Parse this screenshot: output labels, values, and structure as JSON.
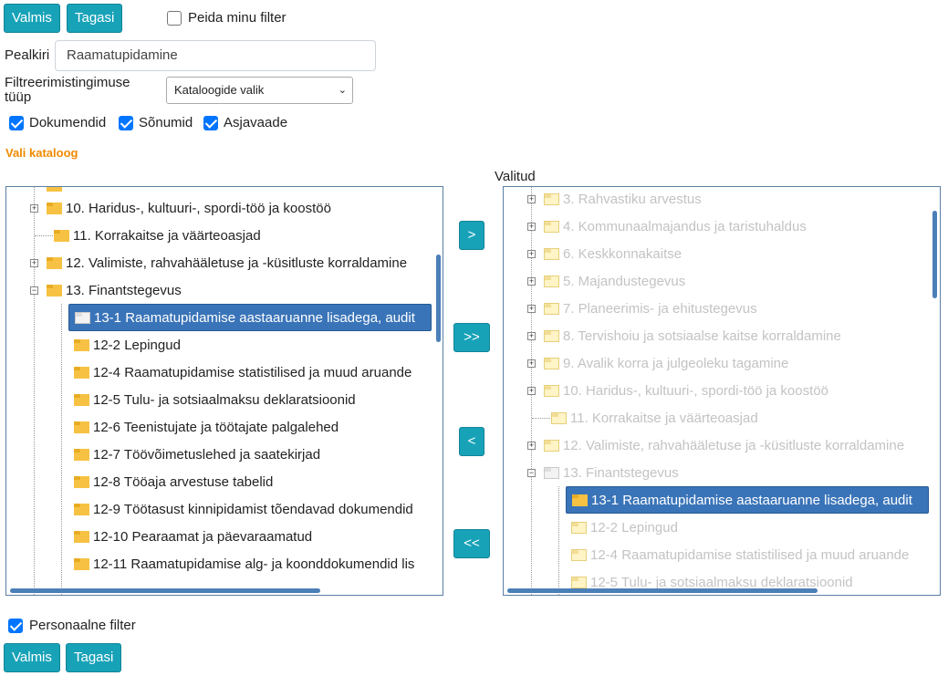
{
  "top_buttons": {
    "done": "Valmis",
    "back": "Tagasi"
  },
  "hide_filter": {
    "label": "Peida minu filter",
    "checked": false
  },
  "title_field": {
    "label": "Pealkiri",
    "value": "Raamatupidamine"
  },
  "filter_type": {
    "label": "Filtreerimistingimuse tüüp",
    "selected": "Kataloogide valik"
  },
  "types": [
    {
      "label": "Dokumendid",
      "checked": true
    },
    {
      "label": "Sõnumid",
      "checked": true
    },
    {
      "label": "Asjavaade",
      "checked": true
    }
  ],
  "catalog_heading": "Vali kataloog",
  "selected_heading": "Valitud",
  "left_tree": [
    {
      "label": "10. Haridus-, kultuuri-, spordi-töö ja koostöö"
    },
    {
      "label": "11. Korrakaitse ja väärteoasjad"
    },
    {
      "label": "12. Valimiste, rahvahääletuse ja -küsitluste korraldamine"
    },
    {
      "label": "13. Finantstegevus"
    },
    {
      "label": "13-1 Raamatupidamise aastaaruanne lisadega, audit"
    },
    {
      "label": "12-2 Lepingud"
    },
    {
      "label": "12-4 Raamatupidamise statistilised ja muud aruande"
    },
    {
      "label": "12-5 Tulu- ja sotsiaalmaksu deklaratsioonid"
    },
    {
      "label": "12-6 Teenistujate ja töötajate palgalehed"
    },
    {
      "label": "12-7 Töövõimetuslehed ja saatekirjad"
    },
    {
      "label": "12-8 Tööaja arvestuse tabelid"
    },
    {
      "label": "12-9 Töötasust kinnipidamist tõendavad dokumendid"
    },
    {
      "label": "12-10 Pearaamat ja päevaraamatud"
    },
    {
      "label": "12-11 Raamatupidamise alg- ja koonddokumendid lis"
    }
  ],
  "right_tree": [
    {
      "label": "3. Rahvastiku arvestus"
    },
    {
      "label": "4. Kommunaalmajandus ja taristuhaldus"
    },
    {
      "label": "6. Keskkonnakaitse"
    },
    {
      "label": "5. Majandustegevus"
    },
    {
      "label": "7. Planeerimis- ja ehitustegevus"
    },
    {
      "label": "8. Tervishoiu ja sotsiaalse kaitse korraldamine"
    },
    {
      "label": "9. Avalik korra ja julgeoleku tagamine"
    },
    {
      "label": "10. Haridus-, kultuuri-, spordi-töö ja koostöö"
    },
    {
      "label": "11. Korrakaitse ja väärteoasjad"
    },
    {
      "label": "12. Valimiste, rahvahääletuse ja -küsitluste korraldamine"
    },
    {
      "label": "13. Finantstegevus"
    },
    {
      "label": "13-1 Raamatupidamise aastaaruanne lisadega, audit"
    },
    {
      "label": "12-2 Lepingud"
    },
    {
      "label": "12-4 Raamatupidamise statistilised ja muud aruande"
    },
    {
      "label": "12-5 Tulu- ja sotsiaalmaksu deklaratsioonid"
    }
  ],
  "move_buttons": {
    "add": ">",
    "add_all": ">>",
    "remove": "<",
    "remove_all": "<<"
  },
  "personal_filter": {
    "label": "Personaalne filter",
    "checked": true
  },
  "bottom_buttons": {
    "done": "Valmis",
    "back": "Tagasi"
  },
  "colors": {
    "accent": "#17a2b8",
    "selection": "#3a74b8",
    "heading_orange": "#f08a00"
  }
}
